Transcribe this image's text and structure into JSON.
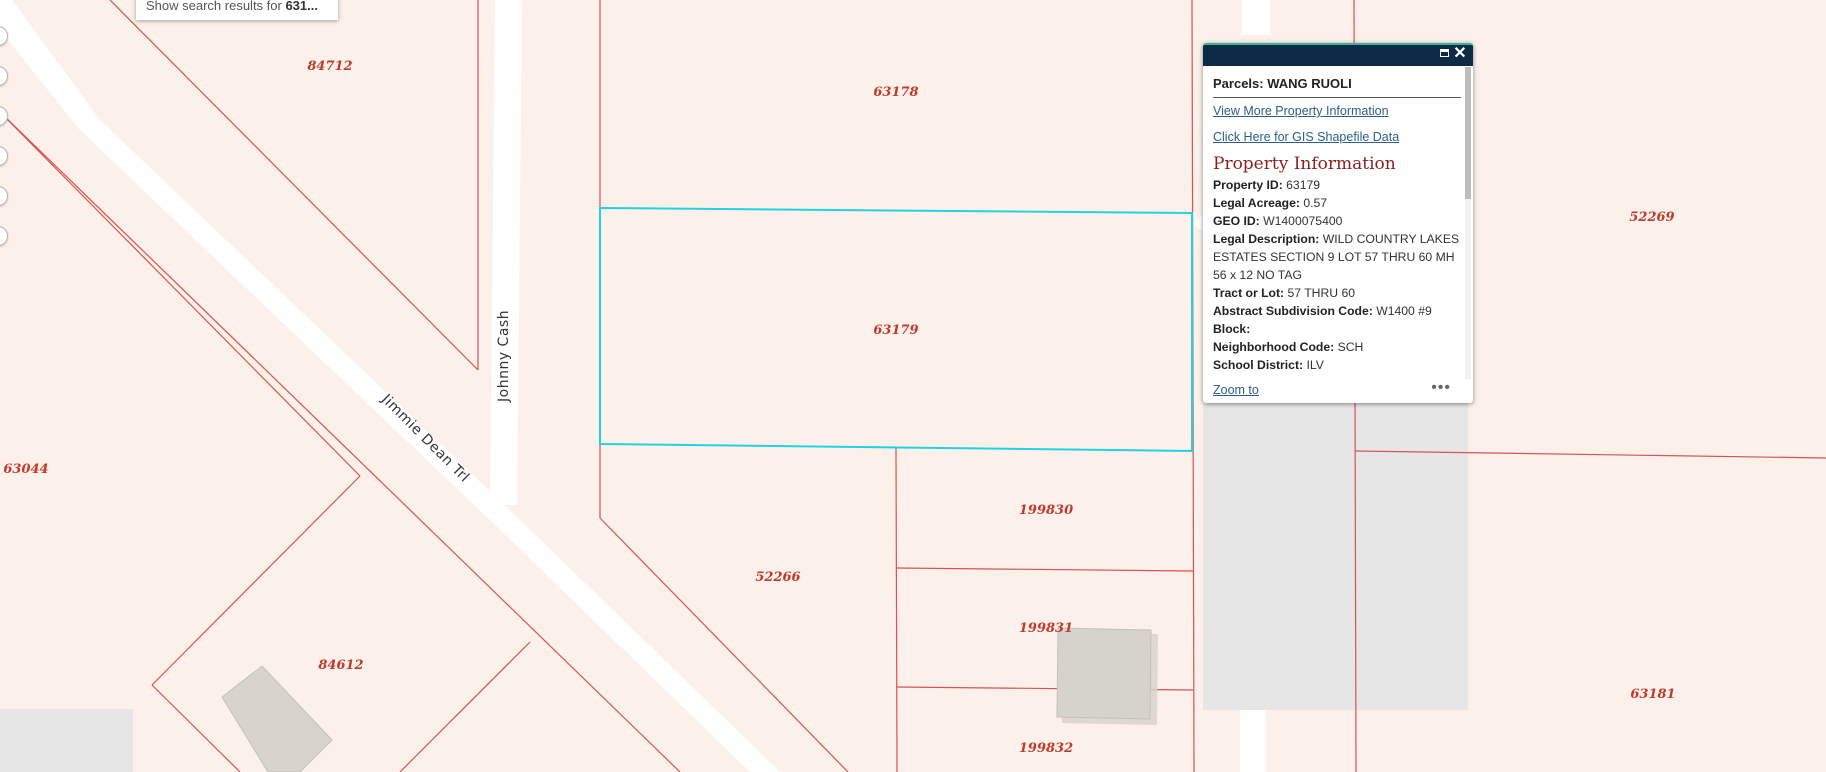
{
  "search": {
    "prefix": "Show search results for ",
    "query": "631..."
  },
  "parcels": [
    {
      "id": "84712"
    },
    {
      "id": "63178"
    },
    {
      "id": "63179"
    },
    {
      "id": "52269"
    },
    {
      "id": "63044"
    },
    {
      "id": "199830"
    },
    {
      "id": "52266"
    },
    {
      "id": "199831"
    },
    {
      "id": "84612"
    },
    {
      "id": "199832"
    },
    {
      "id": "63181"
    }
  ],
  "streets": {
    "johnny": "Johnny Cash",
    "jimmie": "Jimmie Dean Trl"
  },
  "colors": {
    "parcel_line": "#d9534f",
    "highlight": "#1fd3e0",
    "background": "#fbf1ea",
    "road": "#ffffff",
    "header": "#0d2a46"
  },
  "popup": {
    "title_label": "Parcels:",
    "title_value": "WANG RUOLI",
    "link_more": "View More Property Information",
    "link_gis": "Click Here for GIS Shapefile Data",
    "section_title": "Property Information",
    "fields": [
      {
        "k": "Property ID:",
        "v": "63179"
      },
      {
        "k": "Legal Acreage:",
        "v": "0.57"
      },
      {
        "k": "GEO ID:",
        "v": "W1400075400"
      },
      {
        "k": "Legal Description:",
        "v": "WILD COUNTRY LAKES ESTATES SECTION 9 LOT 57 THRU 60 MH 56 x 12 NO TAG"
      },
      {
        "k": "Tract or Lot:",
        "v": "57 THRU 60"
      },
      {
        "k": "Abstract Subdivision Code:",
        "v": "W1400 #9"
      },
      {
        "k": "Block:",
        "v": ""
      },
      {
        "k": "Neighborhood Code:",
        "v": "SCH"
      },
      {
        "k": "School District:",
        "v": "ILV"
      }
    ],
    "zoom_to": "Zoom to",
    "more": "•••"
  }
}
